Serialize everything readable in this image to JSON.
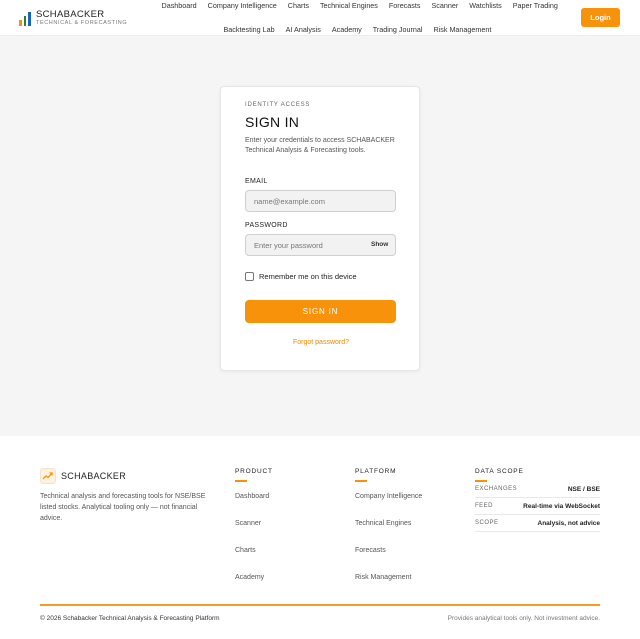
{
  "header": {
    "brand_name": "SCHABACKER",
    "brand_sub": "TECHNICAL & FORECASTING",
    "nav_row1": [
      "Dashboard",
      "Company Intelligence",
      "Charts",
      "Technical Engines",
      "Forecasts",
      "Scanner",
      "Watchlists",
      "Paper Trading"
    ],
    "nav_row2": [
      "Backtesting Lab",
      "AI Analysis",
      "Academy",
      "Trading Journal",
      "Risk Management"
    ],
    "login_label": "Login"
  },
  "signin": {
    "eyebrow": "IDENTITY ACCESS",
    "title": "SIGN IN",
    "description": "Enter your credentials to access SCHABACKER Technical Analysis & Forecasting tools.",
    "email_label": "EMAIL",
    "email_placeholder": "name@example.com",
    "email_value": "",
    "password_label": "PASSWORD",
    "password_placeholder": "Enter your password",
    "password_value": "",
    "show_label": "Show",
    "remember_label": "Remember me on this device",
    "remember_checked": false,
    "submit_label": "SIGN IN",
    "forgot_label": "Forgot password?"
  },
  "footer": {
    "brand_name": "SCHABACKER",
    "description": "Technical analysis and forecasting tools for NSE/BSE listed stocks. Analytical tooling only — not financial advice.",
    "product_title": "PRODUCT",
    "product_links": [
      "Dashboard",
      "Scanner",
      "Charts",
      "Academy"
    ],
    "platform_title": "PLATFORM",
    "platform_links": [
      "Company Intelligence",
      "Technical Engines",
      "Forecasts",
      "Risk Management"
    ],
    "data_scope_title": "DATA SCOPE",
    "data_scope": [
      {
        "key": "EXCHANGES",
        "value": "NSE / BSE"
      },
      {
        "key": "FEED",
        "value": "Real-time via WebSocket"
      },
      {
        "key": "SCOPE",
        "value": "Analysis, not advice"
      }
    ],
    "copyright": "© 2026 Schabacker Technical Analysis & Forecasting Platform",
    "disclaimer": "Provides analytical tools only. Not investment advice."
  },
  "colors": {
    "accent": "#f7920a",
    "brand_bar_1": "#f7920a",
    "brand_bar_2": "#2e7d32",
    "brand_bar_3": "#1565c0"
  }
}
